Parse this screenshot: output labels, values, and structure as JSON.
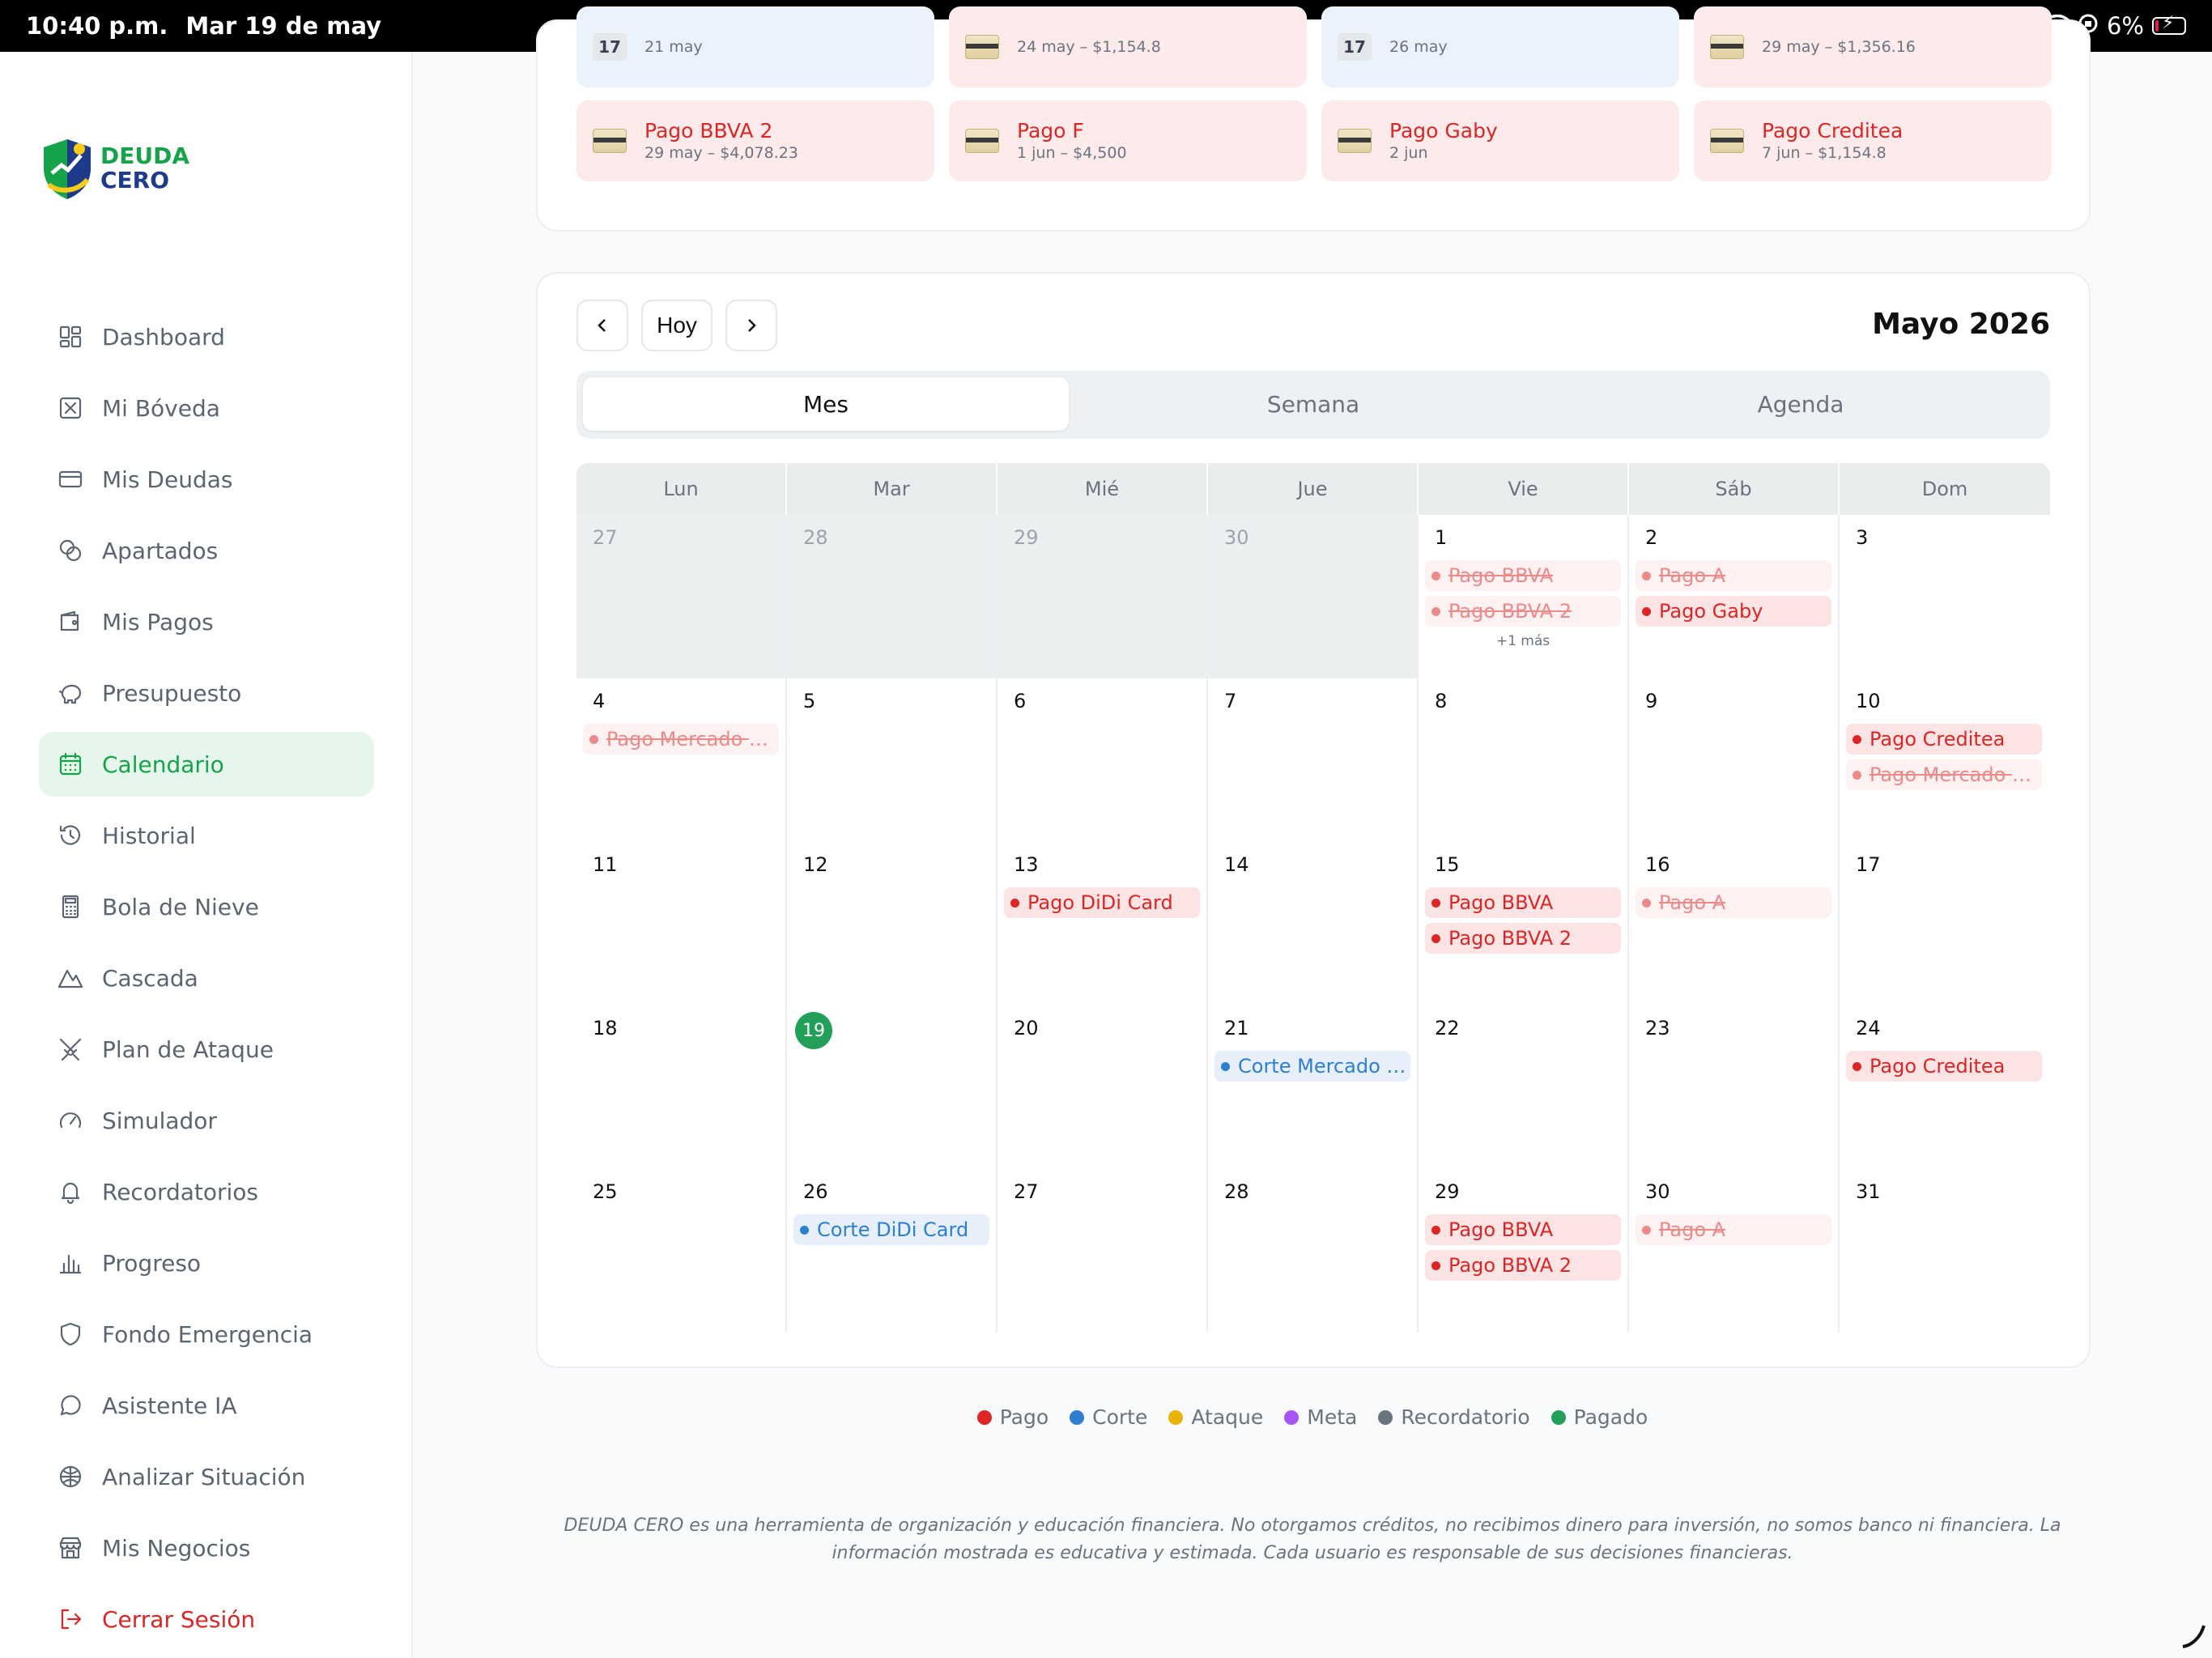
{
  "status_bar": {
    "time": "10:40 p.m.",
    "date": "Mar 19 de may",
    "battery": "6%"
  },
  "logo": {
    "line1": "DEUDA",
    "line2": "CERO"
  },
  "sidebar": {
    "items": [
      {
        "label": "Dashboard",
        "icon": "grid-icon"
      },
      {
        "label": "Mi Bóveda",
        "icon": "vault-icon"
      },
      {
        "label": "Mis Deudas",
        "icon": "credit-card-icon"
      },
      {
        "label": "Apartados",
        "icon": "coins-icon"
      },
      {
        "label": "Mis Pagos",
        "icon": "wallet-icon"
      },
      {
        "label": "Presupuesto",
        "icon": "piggy-bank-icon"
      },
      {
        "label": "Calendario",
        "icon": "calendar-icon",
        "active": true
      },
      {
        "label": "Historial",
        "icon": "history-icon"
      },
      {
        "label": "Bola de Nieve",
        "icon": "calculator-icon"
      },
      {
        "label": "Cascada",
        "icon": "mountain-icon"
      },
      {
        "label": "Plan de Ataque",
        "icon": "swords-icon"
      },
      {
        "label": "Simulador",
        "icon": "gauge-icon"
      },
      {
        "label": "Recordatorios",
        "icon": "bell-icon"
      },
      {
        "label": "Progreso",
        "icon": "bar-chart-icon"
      },
      {
        "label": "Fondo Emergencia",
        "icon": "shield-icon"
      },
      {
        "label": "Asistente IA",
        "icon": "chat-icon"
      },
      {
        "label": "Analizar Situación",
        "icon": "brain-icon"
      },
      {
        "label": "Mis Negocios",
        "icon": "store-icon"
      },
      {
        "label": "Cerrar Sesión",
        "icon": "logout-icon"
      }
    ]
  },
  "upcoming": {
    "row1": [
      {
        "title": "",
        "sub": "21 may",
        "kind": "blue",
        "icon": "calendar-17-icon",
        "icon_text": "17"
      },
      {
        "title": "",
        "sub": "24 may – $1,154.8",
        "kind": "red",
        "icon": "card-icon"
      },
      {
        "title": "",
        "sub": "26 may",
        "kind": "blue",
        "icon": "calendar-17-icon",
        "icon_text": "17"
      },
      {
        "title": "",
        "sub": "29 may – $1,356.16",
        "kind": "red",
        "icon": "card-icon"
      }
    ],
    "row2": [
      {
        "title": "Pago BBVA 2",
        "sub": "29 may – $4,078.23",
        "kind": "red",
        "icon": "card-icon"
      },
      {
        "title": "Pago F",
        "sub": "1 jun – $4,500",
        "kind": "red",
        "icon": "card-icon"
      },
      {
        "title": "Pago Gaby",
        "sub": "2 jun",
        "kind": "red",
        "icon": "card-icon"
      },
      {
        "title": "Pago Creditea",
        "sub": "7 jun – $1,154.8",
        "kind": "red",
        "icon": "card-icon"
      }
    ]
  },
  "calendar": {
    "today_label": "Hoy",
    "month_title": "Mayo 2026",
    "views": [
      "Mes",
      "Semana",
      "Agenda"
    ],
    "active_view": "Mes",
    "weekdays": [
      "Lun",
      "Mar",
      "Mié",
      "Jue",
      "Vie",
      "Sáb",
      "Dom"
    ],
    "weeks": [
      [
        {
          "d": "27",
          "other": true,
          "events": []
        },
        {
          "d": "28",
          "other": true,
          "events": []
        },
        {
          "d": "29",
          "other": true,
          "events": []
        },
        {
          "d": "30",
          "other": true,
          "events": []
        },
        {
          "d": "1",
          "events": [
            {
              "t": "Pago BBVA",
              "k": "paid"
            },
            {
              "t": "Pago BBVA 2",
              "k": "paid"
            }
          ],
          "more": "+1 más"
        },
        {
          "d": "2",
          "events": [
            {
              "t": "Pago A",
              "k": "paid"
            },
            {
              "t": "Pago Gaby",
              "k": "pago"
            }
          ]
        },
        {
          "d": "3",
          "events": []
        }
      ],
      [
        {
          "d": "4",
          "events": [
            {
              "t": "Pago Mercado Pa...",
              "k": "paid"
            }
          ]
        },
        {
          "d": "5",
          "events": []
        },
        {
          "d": "6",
          "events": []
        },
        {
          "d": "7",
          "events": []
        },
        {
          "d": "8",
          "events": []
        },
        {
          "d": "9",
          "events": []
        },
        {
          "d": "10",
          "events": [
            {
              "t": "Pago Creditea",
              "k": "pago"
            },
            {
              "t": "Pago Mercado Cr...",
              "k": "paid"
            }
          ]
        }
      ],
      [
        {
          "d": "11",
          "events": []
        },
        {
          "d": "12",
          "events": []
        },
        {
          "d": "13",
          "events": [
            {
              "t": "Pago DiDi Card",
              "k": "pago"
            }
          ]
        },
        {
          "d": "14",
          "events": []
        },
        {
          "d": "15",
          "events": [
            {
              "t": "Pago BBVA",
              "k": "pago"
            },
            {
              "t": "Pago BBVA 2",
              "k": "pago"
            }
          ]
        },
        {
          "d": "16",
          "events": [
            {
              "t": "Pago A",
              "k": "paid"
            }
          ]
        },
        {
          "d": "17",
          "events": []
        }
      ],
      [
        {
          "d": "18",
          "events": []
        },
        {
          "d": "19",
          "today": true,
          "events": []
        },
        {
          "d": "20",
          "events": []
        },
        {
          "d": "21",
          "events": [
            {
              "t": "Corte Mercado P...",
              "k": "corte"
            }
          ]
        },
        {
          "d": "22",
          "events": []
        },
        {
          "d": "23",
          "events": []
        },
        {
          "d": "24",
          "events": [
            {
              "t": "Pago Creditea",
              "k": "pago"
            }
          ]
        }
      ],
      [
        {
          "d": "25",
          "events": []
        },
        {
          "d": "26",
          "events": [
            {
              "t": "Corte DiDi Card",
              "k": "corte"
            }
          ]
        },
        {
          "d": "27",
          "events": []
        },
        {
          "d": "28",
          "events": []
        },
        {
          "d": "29",
          "events": [
            {
              "t": "Pago BBVA",
              "k": "pago"
            },
            {
              "t": "Pago BBVA 2",
              "k": "pago"
            }
          ]
        },
        {
          "d": "30",
          "events": [
            {
              "t": "Pago A",
              "k": "paid"
            }
          ]
        },
        {
          "d": "31",
          "events": []
        }
      ]
    ]
  },
  "legend": [
    {
      "label": "Pago",
      "color": "#dc2626"
    },
    {
      "label": "Corte",
      "color": "#2f7fd1"
    },
    {
      "label": "Ataque",
      "color": "#eab308"
    },
    {
      "label": "Meta",
      "color": "#a855f7"
    },
    {
      "label": "Recordatorio",
      "color": "#6b7280"
    },
    {
      "label": "Pagado",
      "color": "#22a05a"
    }
  ],
  "disclaimer": "DEUDA CERO es una herramienta de organización y educación financiera. No otorgamos créditos, no recibimos dinero para inversión, no somos banco ni financiera. La información mostrada es educativa y estimada. Cada usuario es responsable de sus decisiones financieras."
}
